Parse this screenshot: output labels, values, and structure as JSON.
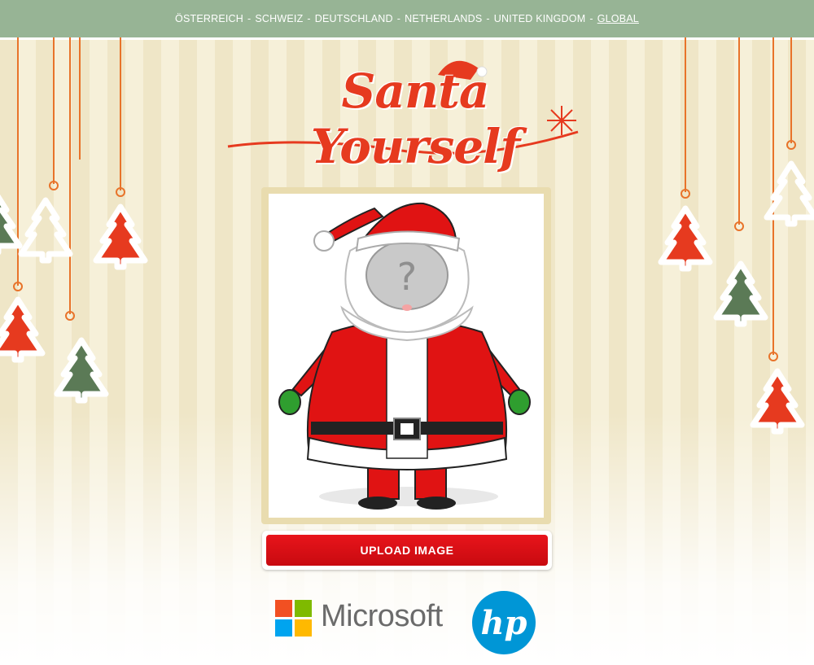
{
  "countries": [
    {
      "label": "ÖSTERREICH"
    },
    {
      "label": "SCHWEIZ"
    },
    {
      "label": "DEUTSCHLAND"
    },
    {
      "label": "NETHERLANDS"
    },
    {
      "label": "UNITED KINGDOM"
    },
    {
      "label": "GLOBAL",
      "active": true
    }
  ],
  "separator": "-",
  "logo": {
    "text": "Santa Yourself"
  },
  "photo": {
    "placeholder_mark": "?"
  },
  "upload": {
    "label": "UPLOAD IMAGE"
  },
  "sponsors": {
    "microsoft": "Microsoft",
    "hp": "hp"
  },
  "colors": {
    "topbar": "#97b495",
    "red_tree": "#e63a1f",
    "green_tree": "#5b7a56",
    "button": "#d9101a",
    "ms_red": "#f25022",
    "ms_green": "#7fba00",
    "ms_blue": "#00a4ef",
    "ms_yellow": "#ffb900",
    "hp_blue": "#0096d6"
  }
}
